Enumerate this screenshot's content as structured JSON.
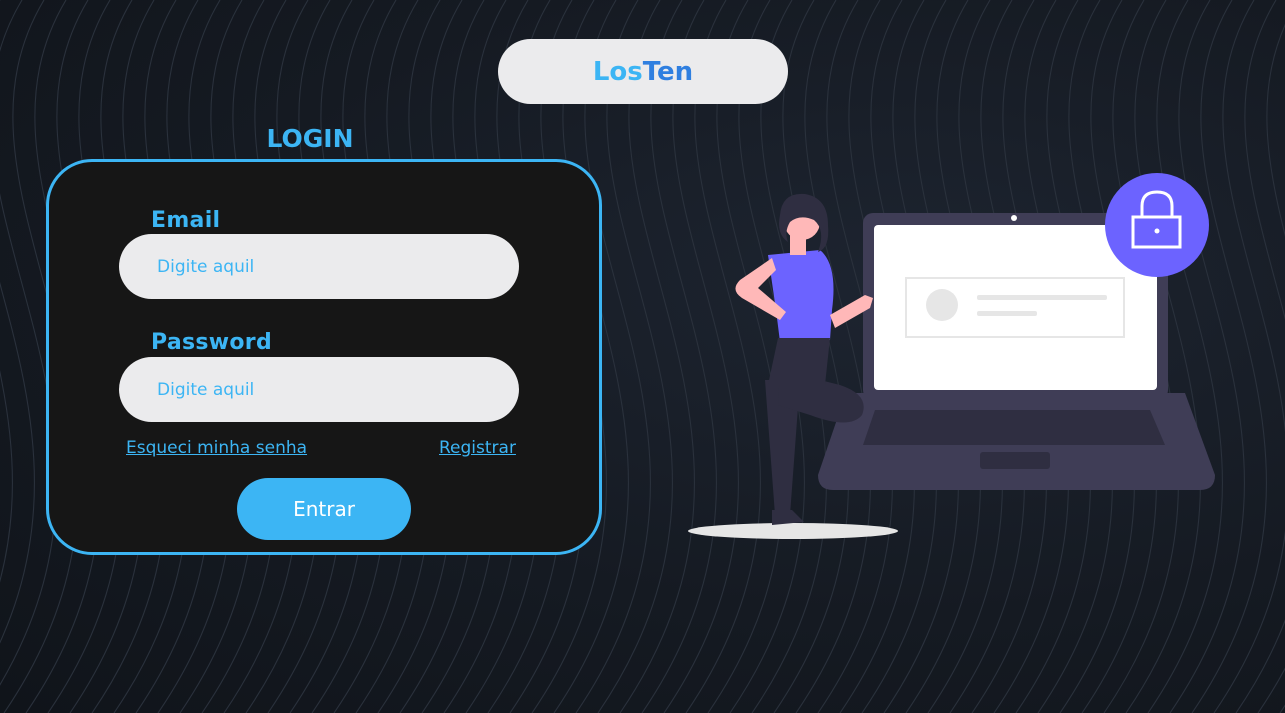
{
  "brand": {
    "part1": "Los",
    "part2": "Ten"
  },
  "login": {
    "title": "LOGIN",
    "email_label": "Email",
    "email_placeholder": "Digite aquil",
    "email_value": "",
    "password_label": "Password",
    "password_placeholder": "Digite aquil",
    "password_value": "",
    "forgot_link": "Esqueci minha senha",
    "register_link": "Registrar",
    "submit_label": "Entrar"
  },
  "illustration": {
    "icons": [
      "lock-icon",
      "laptop-icon",
      "person-figure"
    ]
  },
  "colors": {
    "accent": "#3cb5f4",
    "brand_dark": "#2f7fe0",
    "card_bg": "#161616",
    "input_bg": "#ebebed",
    "lock_circle": "#6c63ff",
    "page_bg": "#151a22"
  }
}
